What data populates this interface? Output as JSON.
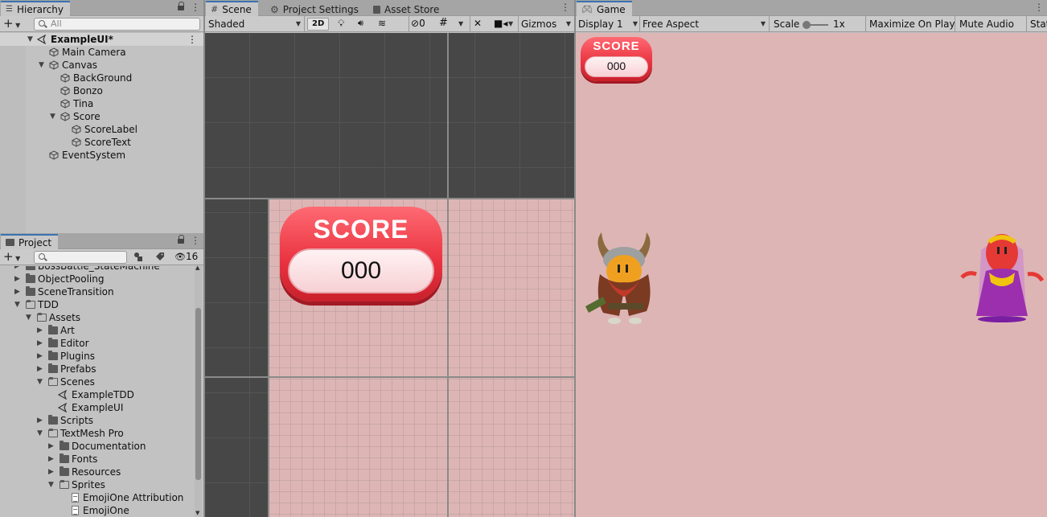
{
  "hierarchy": {
    "tab_label": "Hierarchy",
    "search_placeholder": "All",
    "scene_name": "ExampleUI*",
    "items": [
      {
        "label": "Main Camera"
      },
      {
        "label": "Canvas"
      },
      {
        "label": "BackGround"
      },
      {
        "label": "Bonzo"
      },
      {
        "label": "Tina"
      },
      {
        "label": "Score"
      },
      {
        "label": "ScoreLabel"
      },
      {
        "label": "ScoreText"
      },
      {
        "label": "EventSystem"
      }
    ]
  },
  "project": {
    "tab_label": "Project",
    "hidden_count": "16",
    "items": [
      {
        "label": "BossBattle_StateMachine"
      },
      {
        "label": "ObjectPooling"
      },
      {
        "label": "SceneTransition"
      },
      {
        "label": "TDD"
      },
      {
        "label": "Assets"
      },
      {
        "label": "Art"
      },
      {
        "label": "Editor"
      },
      {
        "label": "Plugins"
      },
      {
        "label": "Prefabs"
      },
      {
        "label": "Scenes"
      },
      {
        "label": "ExampleTDD"
      },
      {
        "label": "ExampleUI"
      },
      {
        "label": "Scripts"
      },
      {
        "label": "TextMesh Pro"
      },
      {
        "label": "Documentation"
      },
      {
        "label": "Fonts"
      },
      {
        "label": "Resources"
      },
      {
        "label": "Sprites"
      },
      {
        "label": "EmojiOne Attribution"
      },
      {
        "label": "EmojiOne"
      }
    ]
  },
  "scene": {
    "tabs": [
      "Scene",
      "Project Settings",
      "Asset Store"
    ],
    "shading_mode": "Shaded",
    "mode_2d": "2D",
    "hidden_layers": "0",
    "gizmos_label": "Gizmos"
  },
  "score": {
    "title": "SCORE",
    "value": "000"
  },
  "game": {
    "tab_label": "Game",
    "display": "Display 1",
    "aspect": "Free Aspect",
    "scale_label": "Scale",
    "scale_value": "1x",
    "maximize": "Maximize On Play",
    "mute": "Mute Audio",
    "stats": "Stats"
  },
  "colors": {
    "accent": "#3a72b0",
    "canvas_bg": "#deb5b5",
    "score_red": "#e8313e"
  }
}
